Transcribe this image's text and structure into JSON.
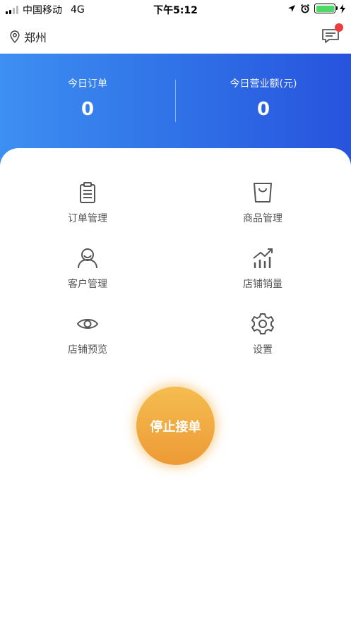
{
  "status_bar": {
    "carrier": "中国移动",
    "network": "4G",
    "time": "下午5:12"
  },
  "header": {
    "location": "郑州",
    "notification_dot_color": "#ee3b3b"
  },
  "stats": {
    "orders_label": "今日订单",
    "orders_value": "0",
    "revenue_label": "今日营业额(元)",
    "revenue_value": "0"
  },
  "menu": {
    "order_management": {
      "label": "订单管理",
      "icon": "clipboard-icon"
    },
    "product_management": {
      "label": "商品管理",
      "icon": "shopping-bag-icon"
    },
    "customer_management": {
      "label": "客户管理",
      "icon": "user-icon"
    },
    "store_sales": {
      "label": "店铺销量",
      "icon": "bar-chart-icon"
    },
    "store_preview": {
      "label": "店铺预览",
      "icon": "eye-icon"
    },
    "settings": {
      "label": "设置",
      "icon": "gear-icon"
    }
  },
  "actions": {
    "stop_orders_label": "停止接单"
  },
  "colors": {
    "banner_start": "#3d8ff2",
    "banner_end": "#2753dd",
    "button_start": "#f4bd4f",
    "button_end": "#ee9a36"
  }
}
